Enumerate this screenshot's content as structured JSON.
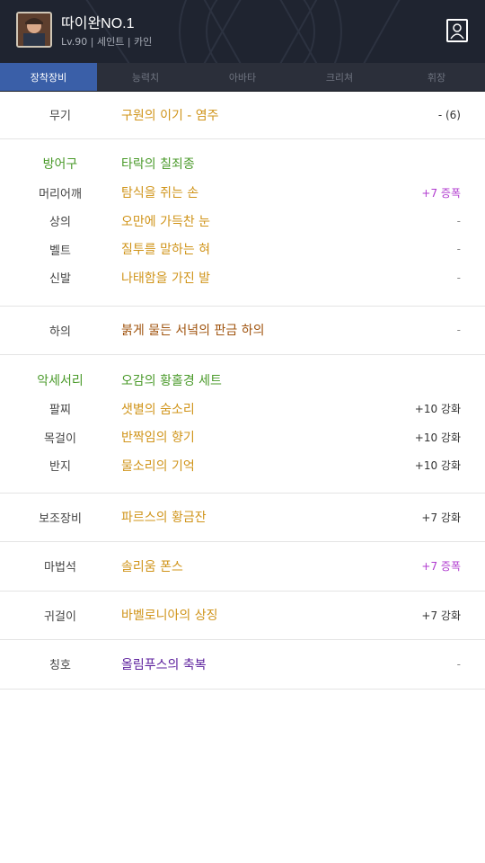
{
  "header": {
    "name": "따이완NO.1",
    "info": "Lv.90 | 세인트 | 카인"
  },
  "tabs": [
    {
      "label": "장착장비",
      "active": true
    },
    {
      "label": "능력치",
      "active": false
    },
    {
      "label": "아바타",
      "active": false
    },
    {
      "label": "크리쳐",
      "active": false
    },
    {
      "label": "휘장",
      "active": false
    }
  ],
  "weapon": {
    "slot": "무기",
    "name": "구원의 이기 - 염주",
    "value": "- (6)"
  },
  "armor": {
    "set_slot": "방어구",
    "set_name": "타락의 칠죄종",
    "items": [
      {
        "slot": "머리어깨",
        "name": "탐식을 쥐는 손",
        "value": "+7 증폭"
      },
      {
        "slot": "상의",
        "name": "오만에 가득찬 눈",
        "value": "-"
      },
      {
        "slot": "벨트",
        "name": "질투를 말하는 혀",
        "value": "-"
      },
      {
        "slot": "신발",
        "name": "나태함을 가진 발",
        "value": "-"
      }
    ]
  },
  "pants": {
    "slot": "하의",
    "name": "붉게 물든 서녘의 판금 하의",
    "value": "-"
  },
  "accessory": {
    "set_slot": "악세서리",
    "set_name": "오감의 황홀경 세트",
    "items": [
      {
        "slot": "팔찌",
        "name": "샛별의 숨소리",
        "value": "+10 강화"
      },
      {
        "slot": "목걸이",
        "name": "반짝임의 향기",
        "value": "+10 강화"
      },
      {
        "slot": "반지",
        "name": "물소리의 기억",
        "value": "+10 강화"
      }
    ]
  },
  "sub": {
    "slot": "보조장비",
    "name": "파르스의 황금잔",
    "value": "+7 강화"
  },
  "magic": {
    "slot": "마법석",
    "name": "솔리움 폰스",
    "value": "+7 증폭"
  },
  "earring": {
    "slot": "귀걸이",
    "name": "바벨로니아의 상징",
    "value": "+7 강화"
  },
  "title": {
    "slot": "칭호",
    "name": "올림푸스의 축복",
    "value": "-"
  },
  "colors": {
    "header_bg": "#1f2430",
    "tab_active": "#3a5fa8",
    "set_green": "#4a9a2a",
    "epic_gold": "#d0941a",
    "legend_brown": "#a0540f",
    "unique_purple": "#5b1e9c",
    "amplify_magenta": "#b03bcf"
  }
}
